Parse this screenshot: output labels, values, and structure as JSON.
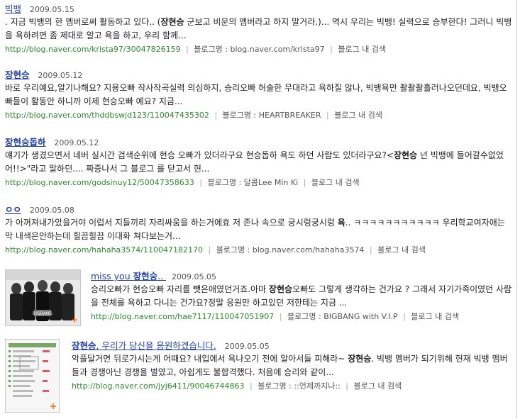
{
  "results": [
    {
      "title": "빅뱅",
      "date": "2009.05.15",
      "snippet": [
        [
          ". 지금 빅뱅의 한 멤버로써 활동하고 있다.. (",
          false
        ],
        [
          "장현승",
          true
        ],
        [
          " 군보고 비운의 멤버라고 하지 말거라.)... 역시 우리는 빅뱅! 실력으로 승부한다! 그러니 빅뱅을 욕하려면 좀 제대로 알고 욕을 하고, 우리 함께...",
          false
        ]
      ],
      "url": "http://blog.naver.com/krista97/30047826159",
      "blogname": "블로그명 : blog.naver.com/krista97",
      "more": "블로그 내 검색"
    },
    {
      "title": "장현승",
      "date": "2009.05.12",
      "snippet": [
        [
          "바로 우리예요,알기나해요? 지용오빠 작사작곡실력 의심하지, 승리오빠 허술한 무대라고 욕하질 않나, 빅뱅욕만 좔좔좔흘러나오던데요, 빅뱅오빠들이 활동안 하니까 이제 현승오빠 예요? 지금...",
          false
        ]
      ],
      "url": "http://blog.naver.com/thddbswjd123/110047435302",
      "blogname": "블로그명 : HEARTBREAKER",
      "more": "블로그 내 검색"
    },
    {
      "title": "장현승돕하",
      "date": "2009.05.12",
      "snippet": [
        [
          "얘기가 생겼으면서 네버 실시간 검색순위에 현승 오빠가 있더라구요 현승돕하 욕도 하던 사람도 있더라구요?<",
          false
        ],
        [
          "장현승",
          true
        ],
        [
          " 넌 빅뱅에 들어갈수없었어!!>\"라고 말하던.... 짜증나서 그 블로그 를 닫고서 현...",
          false
        ]
      ],
      "url": "http://blog.naver.com/godsinuy12/50047358633",
      "blogname": "블로그명 : 달콤Lee Min Ki",
      "more": "블로그 내 검색"
    },
    {
      "title": "ㅇㅇ",
      "date": "2009.05.08",
      "snippet": [
        [
          "가 아꺼져내가았을거야 이럽서 지들끼리 자리싸움을 하는거에효 저 존나 속으로 궁시렁궁시렁 ",
          false
        ],
        [
          "욕",
          true
        ],
        [
          ".. ㅋㅋㅋㅋㅋㅋㅋㅋㅋㅋㅋ 우리학교여자애는 막 내색은안하는데 힐끔힐끔 이대화 쳐다보는거...",
          false
        ]
      ],
      "url": "http://blog.naver.com/hahaha3574/110047182170",
      "blogname": "블로그명 : blog.naver.com/hahaha3574",
      "more": "블로그 내 검색"
    },
    {
      "title_parts": [
        [
          "miss you ",
          false
        ],
        [
          "장현승",
          true
        ],
        [
          ".. ",
          false
        ]
      ],
      "date": "2009.05.05",
      "snippet": [
        [
          "승리오빠가 현승오빠 자리를 뺏은애였던거죠.아마 ",
          false
        ],
        [
          "장현승",
          true
        ],
        [
          "오빠도 그렇게 생각하는 건가요 ? 그래서 자기가족이였던 사람을 전체를 욕하고 다니는 건가요?정말 응원만 하고있던 저한테는 지금 ...",
          false
        ]
      ],
      "url": "http://blog.naver.com/hae7117/110047051907",
      "blogname": "블로그명 : BIGBANG with V.I.P",
      "more": "블로그 내 검색",
      "thumb_caption": "BIGBANG"
    },
    {
      "title_parts": [
        [
          "장현승",
          true
        ],
        [
          ", 우리가 당신을 응원하겠습니다.",
          false
        ]
      ],
      "date": "2009.05.05",
      "snippet": [
        [
          "악플달거면 뒤로가시는게 어때요? 내입에서 욕나오기 전에 알아서들 피해라~ ",
          false
        ],
        [
          "장현승",
          true
        ],
        [
          ". 빅뱅 멤버가 되기위해 현재 빅뱅 멤버들과 경쟁아닌 경쟁을 벌였고, 아쉽게도 불합격했다. 처음에 승리와 같이...",
          false
        ]
      ],
      "url": "http://blog.naver.com/jyj6411/90046744863",
      "blogname": "블로그명 : ::언제까지나::",
      "more": "블로그 내 검색"
    }
  ],
  "colors": {
    "link": "#1f3fa6",
    "url": "#2d8a2d",
    "plus": "#ff6a00"
  }
}
